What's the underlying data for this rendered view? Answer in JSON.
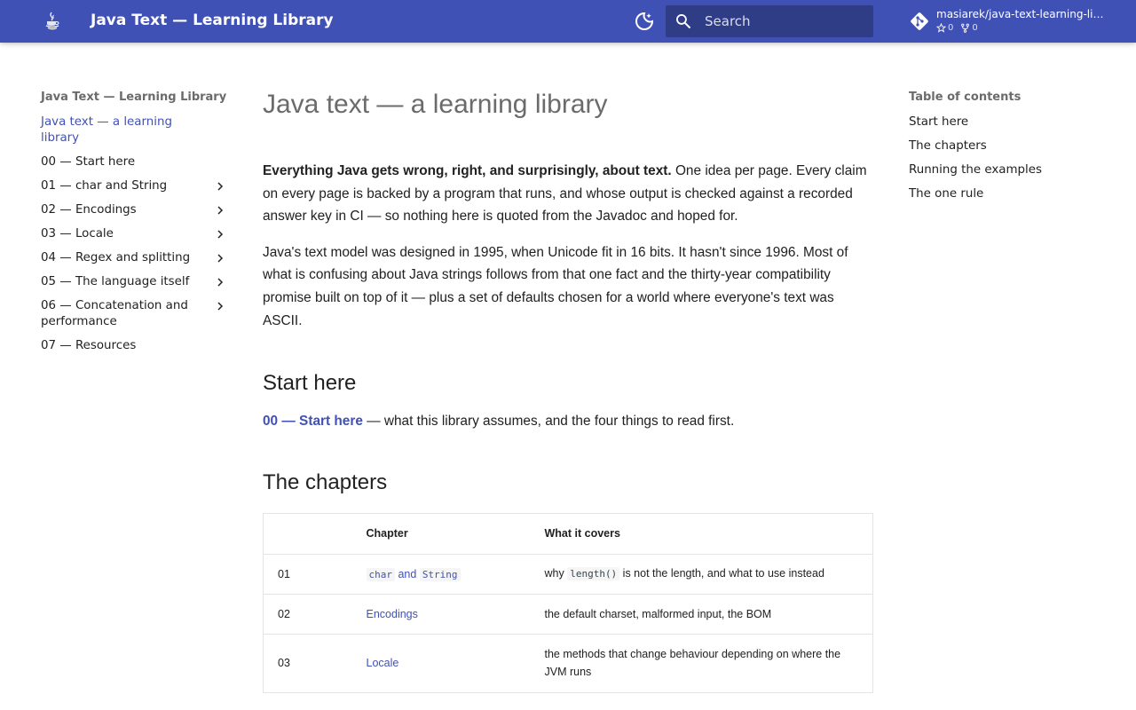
{
  "header": {
    "site_title": "Java Text — Learning Library",
    "search_placeholder": "Search",
    "repo_name": "masiarek/java-text-learning-library",
    "stars": "0",
    "forks": "0",
    "icons": [
      "java-logo-icon",
      "theme-toggle-icon",
      "search-icon",
      "git-icon",
      "star-icon",
      "fork-icon"
    ]
  },
  "nav": {
    "title": "Java Text — Learning Library",
    "items": [
      {
        "label": "Java text — a learning library",
        "active": true,
        "expandable": false
      },
      {
        "label": "00 — Start here",
        "active": false,
        "expandable": false
      },
      {
        "label": "01 — char and String",
        "active": false,
        "expandable": true
      },
      {
        "label": "02 — Encodings",
        "active": false,
        "expandable": true
      },
      {
        "label": "03 — Locale",
        "active": false,
        "expandable": true
      },
      {
        "label": "04 — Regex and splitting",
        "active": false,
        "expandable": true
      },
      {
        "label": "05 — The language itself",
        "active": false,
        "expandable": true
      },
      {
        "label": "06 — Concatenation and performance",
        "active": false,
        "expandable": true
      },
      {
        "label": "07 — Resources",
        "active": false,
        "expandable": false
      }
    ]
  },
  "main": {
    "title": "Java text — a learning library",
    "intro_bold": "Everything Java gets wrong, right, and surprisingly, about text.",
    "intro_rest": " One idea per page. Every claim on every page is backed by a program that runs, and whose output is checked against a recorded answer key in CI — so nothing here is quoted from the Javadoc and hoped for.",
    "para2": "Java's text model was designed in 1995, when Unicode fit in 16 bits. It hasn't since 1996. Most of what is confusing about Java strings follows from that one fact and the thirty-year compatibility promise built on top of it — plus a set of defaults chosen for a world where everyone's text was ASCII.",
    "start_heading": "Start here",
    "start_link": "00 — Start here",
    "start_rest": " — what this library assumes, and the four things to read first.",
    "chapters_heading": "The chapters",
    "table": {
      "headers": [
        "",
        "Chapter",
        "What it covers"
      ],
      "rows": [
        {
          "num": "01",
          "chapter_code1": "char",
          "chapter_and": " and ",
          "chapter_code2": "String",
          "desc_pre": "why ",
          "desc_code": "length()",
          "desc_post": " is not the length, and what to use instead"
        },
        {
          "num": "02",
          "chapter": "Encodings",
          "desc": "the default charset, malformed input, the BOM"
        },
        {
          "num": "03",
          "chapter": "Locale",
          "desc": "the methods that change behaviour depending on where the JVM runs"
        }
      ]
    }
  },
  "toc": {
    "title": "Table of contents",
    "items": [
      "Start here",
      "The chapters",
      "Running the examples",
      "The one rule"
    ]
  },
  "colors": {
    "primary": "#4051b5",
    "text": "#212121",
    "muted": "#6b6b6b"
  }
}
